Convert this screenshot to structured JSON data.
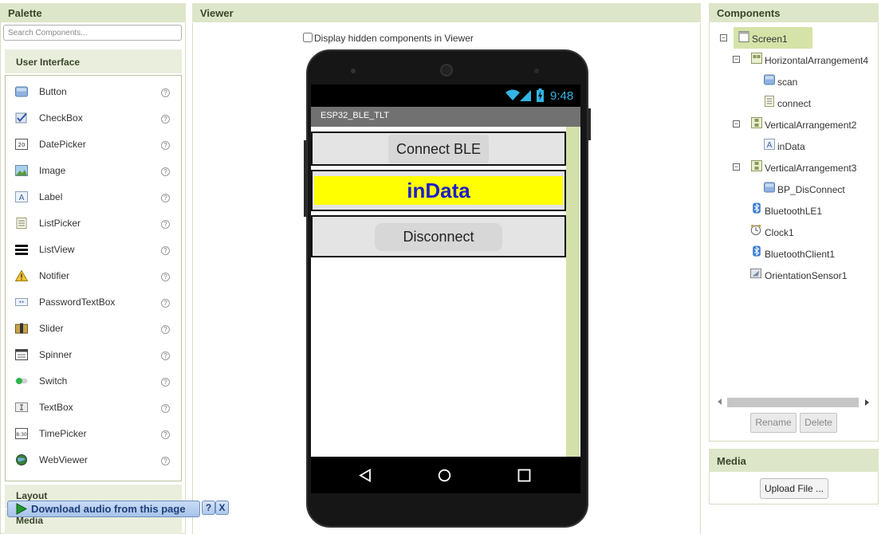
{
  "palette": {
    "title": "Palette",
    "search_placeholder": "Search Components...",
    "section_user_interface": "User Interface",
    "items": [
      {
        "label": "Button",
        "icon": "button-icon"
      },
      {
        "label": "CheckBox",
        "icon": "checkbox-icon"
      },
      {
        "label": "DatePicker",
        "icon": "datepicker-icon"
      },
      {
        "label": "Image",
        "icon": "image-icon"
      },
      {
        "label": "Label",
        "icon": "label-icon"
      },
      {
        "label": "ListPicker",
        "icon": "listpicker-icon"
      },
      {
        "label": "ListView",
        "icon": "listview-icon"
      },
      {
        "label": "Notifier",
        "icon": "notifier-icon"
      },
      {
        "label": "PasswordTextBox",
        "icon": "password-icon"
      },
      {
        "label": "Slider",
        "icon": "slider-icon"
      },
      {
        "label": "Spinner",
        "icon": "spinner-icon"
      },
      {
        "label": "Switch",
        "icon": "switch-icon"
      },
      {
        "label": "TextBox",
        "icon": "textbox-icon"
      },
      {
        "label": "TimePicker",
        "icon": "timepicker-icon"
      },
      {
        "label": "WebViewer",
        "icon": "webviewer-icon"
      }
    ],
    "help_glyph": "?",
    "section_layout": "Layout",
    "section_media": "Media"
  },
  "viewer": {
    "title": "Viewer",
    "hidden_components_label": "Display hidden components in Viewer",
    "status_time": "9:48",
    "app_title": "ESP32_BLE_TLT",
    "connect_button": "Connect BLE",
    "indata_label": "inData",
    "disconnect_button": "Disconnect",
    "colors": {
      "indata_bg": "#ffff00",
      "indata_text": "#1d1dcc"
    }
  },
  "components": {
    "title": "Components",
    "tree": [
      {
        "label": "Screen1",
        "icon": "screen-icon",
        "toggle": "⊟"
      },
      {
        "label": "HorizontalArrangement4",
        "icon": "horizontal-arrangement-icon",
        "toggle": "⊟"
      },
      {
        "label": "scan",
        "icon": "button-icon",
        "toggle": ""
      },
      {
        "label": "connect",
        "icon": "listpicker-icon",
        "toggle": ""
      },
      {
        "label": "VerticalArrangement2",
        "icon": "vertical-arrangement-icon",
        "toggle": "⊟"
      },
      {
        "label": "inData",
        "icon": "label-icon",
        "toggle": ""
      },
      {
        "label": "VerticalArrangement3",
        "icon": "vertical-arrangement-icon",
        "toggle": "⊟"
      },
      {
        "label": "BP_DisConnect",
        "icon": "button-icon",
        "toggle": ""
      },
      {
        "label": "BluetoothLE1",
        "icon": "bluetooth-icon",
        "toggle": ""
      },
      {
        "label": "Clock1",
        "icon": "clock-icon",
        "toggle": ""
      },
      {
        "label": "BluetoothClient1",
        "icon": "bluetooth-icon",
        "toggle": ""
      },
      {
        "label": "OrientationSensor1",
        "icon": "orientation-sensor-icon",
        "toggle": ""
      }
    ],
    "rename_button": "Rename",
    "delete_button": "Delete"
  },
  "media": {
    "title": "Media",
    "upload_button": "Upload File ..."
  },
  "download_bar": {
    "label": "Download audio from this page",
    "help": "?",
    "close": "X"
  }
}
